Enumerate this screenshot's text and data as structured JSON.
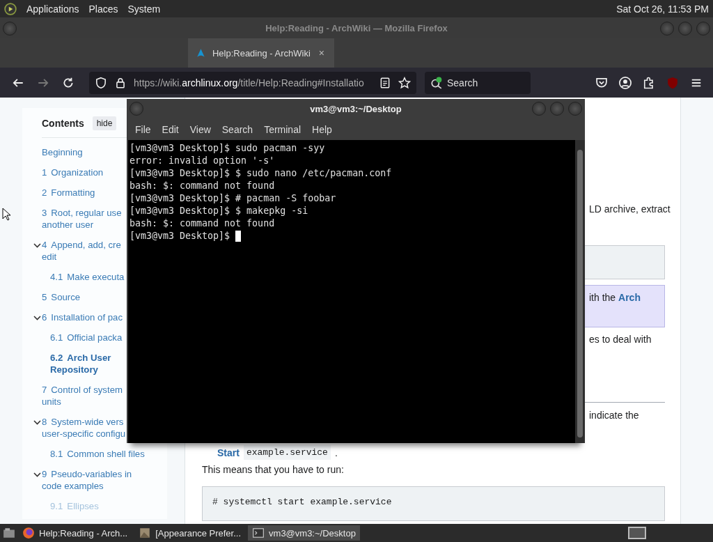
{
  "top_panel": {
    "menus": [
      "Applications",
      "Places",
      "System"
    ],
    "clock": "Sat Oct 26, 11:53 PM"
  },
  "browser": {
    "title": "Help:Reading - ArchWiki — Mozilla Firefox",
    "tabs": [
      {
        "label": "Help:Reading - ArchWiki",
        "close": "×",
        "selected": true
      }
    ],
    "url": {
      "prefix": "https://wiki.",
      "domain": "archlinux.org",
      "path": "/title/Help:Reading#Installatio"
    },
    "search": {
      "placeholder": "Search"
    },
    "toc": {
      "title": "Contents",
      "hide": "hide",
      "items": [
        {
          "lines": [
            "Beginning"
          ],
          "selected": false
        },
        {
          "number": "1",
          "lines": [
            "Organization"
          ],
          "selected": false
        },
        {
          "number": "2",
          "lines": [
            "Formatting"
          ],
          "selected": false
        },
        {
          "number": "3",
          "lines": [
            "Root, regular use",
            "another user"
          ],
          "selected": false
        },
        {
          "number": "4",
          "lines": [
            "Append, add, cre",
            "edit"
          ],
          "selected": false,
          "expanded": true,
          "children": [
            {
              "number": "4.1",
              "lines": [
                "Make executa"
              ],
              "selected": false
            }
          ]
        },
        {
          "number": "5",
          "lines": [
            "Source"
          ],
          "selected": false
        },
        {
          "number": "6",
          "lines": [
            "Installation of pac"
          ],
          "selected": false,
          "expanded": true,
          "children": [
            {
              "number": "6.1",
              "lines": [
                "Official packa"
              ],
              "selected": false
            },
            {
              "number": "6.2",
              "lines": [
                "Arch User",
                "Repository"
              ],
              "selected": true
            }
          ]
        },
        {
          "number": "7",
          "lines": [
            "Control of system",
            "units"
          ],
          "selected": false
        },
        {
          "number": "8",
          "lines": [
            "System-wide vers",
            "user-specific configu"
          ],
          "selected": false,
          "expanded": true,
          "children": [
            {
              "number": "8.1",
              "lines": [
                "Common shell files"
              ],
              "selected": false
            }
          ]
        },
        {
          "number": "9",
          "lines": [
            "Pseudo-variables in",
            "code examples"
          ],
          "selected": false,
          "expanded": true,
          "children": [
            {
              "number": "9.1",
              "lines": [
                "Ellipses"
              ],
              "selected": false
            }
          ]
        }
      ]
    },
    "article": {
      "fragment_1": "LD archive, extract",
      "note_text": "ith the",
      "note_link": "Arch",
      "fragment_2": "es to deal with",
      "fragment_3": "indicate the",
      "start_link": "Start",
      "start_code": "example.service",
      "start_end": ".",
      "paragraph": "This means that you have to run:",
      "code": "# systemctl start example.service"
    }
  },
  "terminal": {
    "title": "vm3@vm3:~/Desktop",
    "menus": [
      "File",
      "Edit",
      "View",
      "Search",
      "Terminal",
      "Help"
    ],
    "lines": [
      "[vm3@vm3 Desktop]$ sudo pacman -syy",
      "error: invalid option '-s'",
      "[vm3@vm3 Desktop]$ $ sudo nano /etc/pacman.conf",
      "bash: $: command not found",
      "[vm3@vm3 Desktop]$ # pacman -S foobar",
      "[vm3@vm3 Desktop]$ $ makepkg -si",
      "bash: $: command not found",
      "[vm3@vm3 Desktop]$ "
    ]
  },
  "taskbar": {
    "items": [
      {
        "kind": "firefox",
        "label": "Help:Reading - Arch...",
        "selected": false
      },
      {
        "kind": "prefs",
        "label": "[Appearance Prefer...",
        "selected": false
      },
      {
        "kind": "terminal",
        "label": "vm3@vm3:~/Desktop",
        "selected": true
      }
    ]
  }
}
